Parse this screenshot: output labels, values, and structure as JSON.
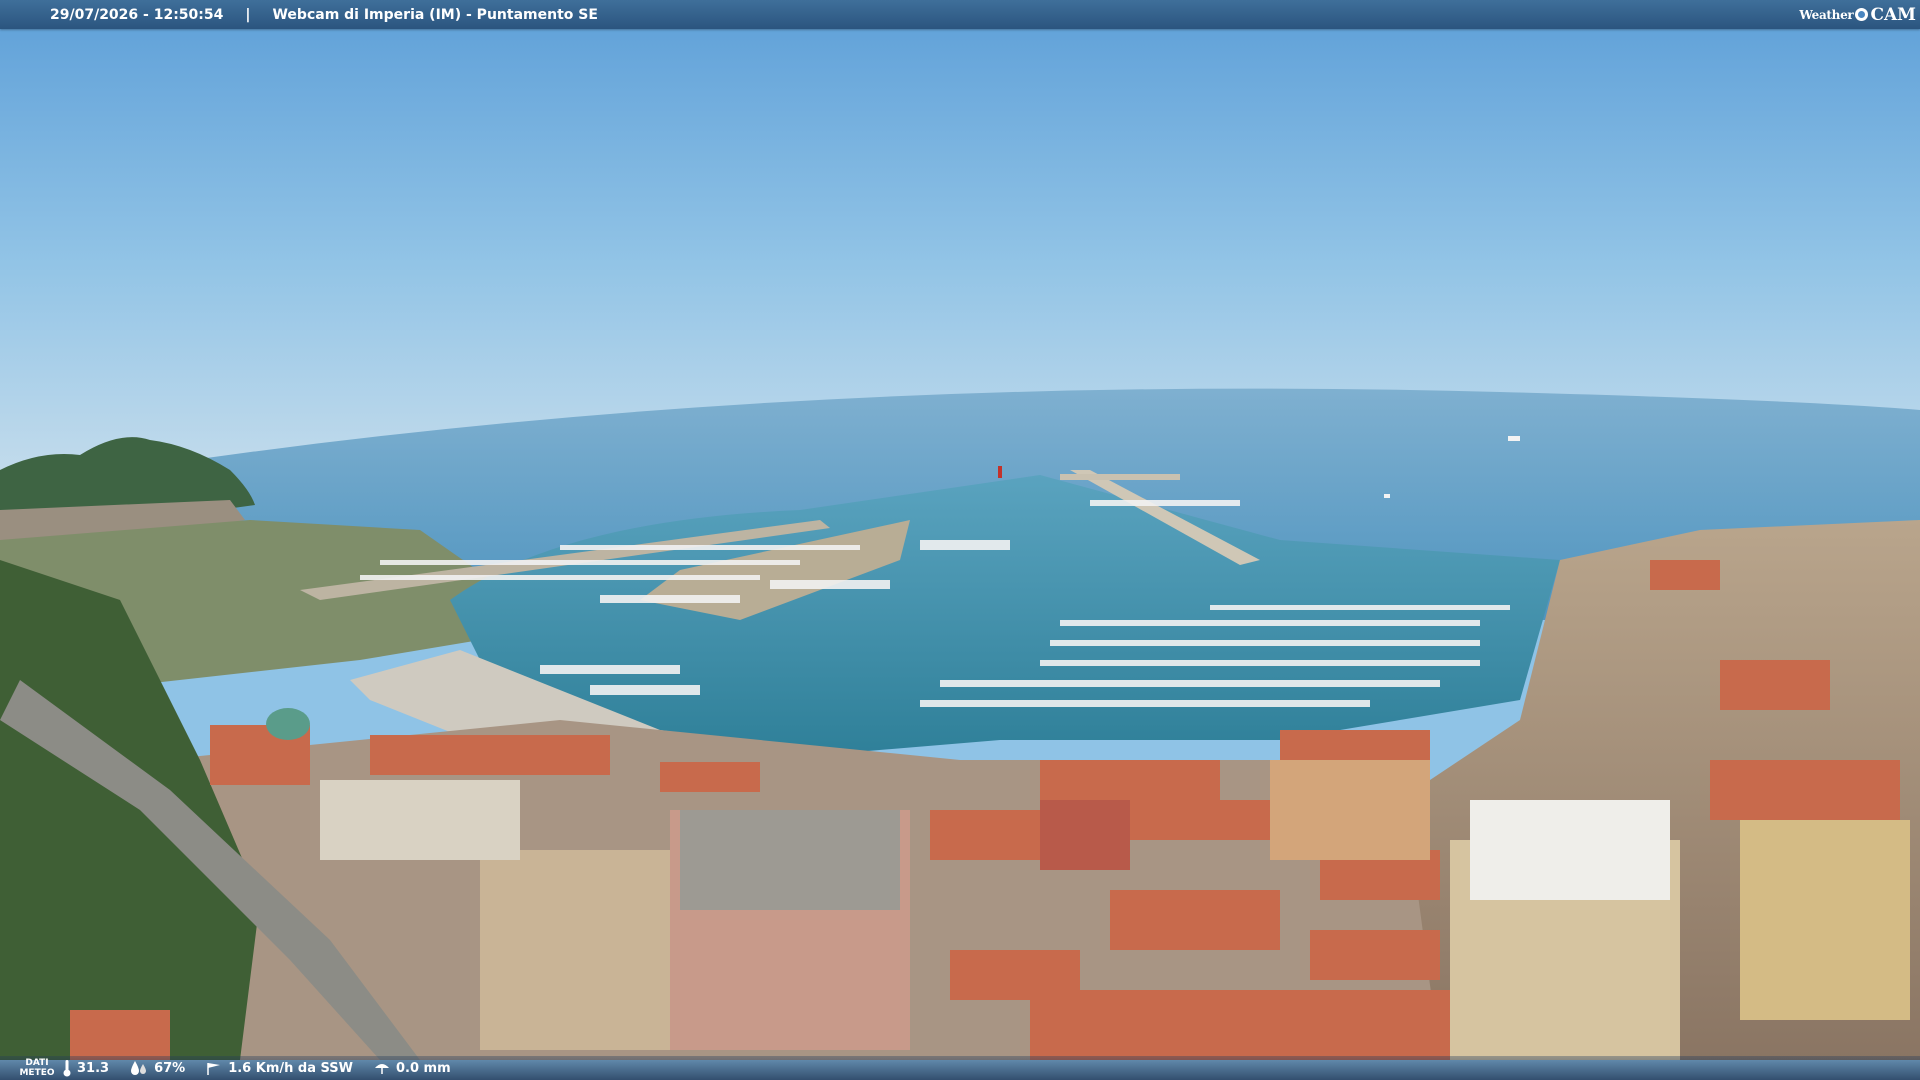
{
  "header": {
    "datetime": "29/07/2026 - 12:50:54",
    "separator": "|",
    "title": "Webcam di Imperia (IM) - Puntamento SE",
    "brand_weather": "Weather",
    "brand_cam": "CAM"
  },
  "weather": {
    "label_line1": "DATI",
    "label_line2": "METEO",
    "temperature": "31.3",
    "humidity": "67%",
    "wind": "1.6 Km/h da SSW",
    "rain": "0.0 mm"
  },
  "icons": [
    "thermometer-icon",
    "humidity-icon",
    "wind-icon",
    "rain-icon"
  ],
  "colors": {
    "sky_top": "#6aa9dd",
    "sky_horizon": "#b7d6ec",
    "sea": "#5f9fc6",
    "harbor_water": "#3d8fa8",
    "roof": "#c8654a",
    "bar": "#2b557f"
  }
}
